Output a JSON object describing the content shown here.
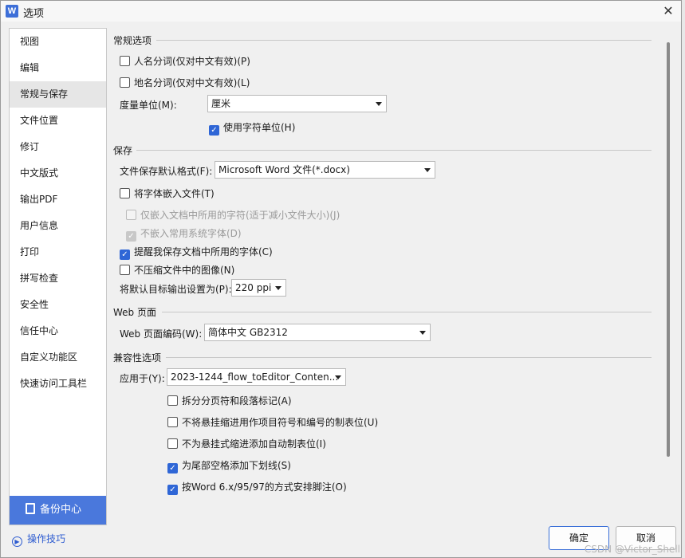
{
  "window": {
    "app_icon": "W",
    "title": "选项",
    "close": "✕"
  },
  "sidebar": {
    "items": [
      {
        "label": "视图"
      },
      {
        "label": "编辑"
      },
      {
        "label": "常规与保存"
      },
      {
        "label": "文件位置"
      },
      {
        "label": "修订"
      },
      {
        "label": "中文版式"
      },
      {
        "label": "输出PDF"
      },
      {
        "label": "用户信息"
      },
      {
        "label": "打印"
      },
      {
        "label": "拼写检查"
      },
      {
        "label": "安全性"
      },
      {
        "label": "信任中心"
      },
      {
        "label": "自定义功能区"
      },
      {
        "label": "快速访问工具栏"
      }
    ],
    "active_index": 2,
    "backup_label": "备份中心"
  },
  "tips_label": "操作技巧",
  "general": {
    "title": "常规选项",
    "person_name": {
      "label": "人名分词(仅对中文有效)(P)",
      "checked": false
    },
    "place_name": {
      "label": "地名分词(仅对中文有效)(L)",
      "checked": false
    },
    "unit_label": "度量单位(M):",
    "unit_value": "厘米",
    "char_unit": {
      "label": "使用字符单位(H)",
      "checked": true
    }
  },
  "save": {
    "title": "保存",
    "format_label": "文件保存默认格式(F):",
    "format_value": "Microsoft Word 文件(*.docx)",
    "embed_fonts": {
      "label": "将字体嵌入文件(T)",
      "checked": false
    },
    "embed_used_only": {
      "label": "仅嵌入文档中所用的字符(适于减小文件大小)(J)",
      "checked": false
    },
    "no_embed_system": {
      "label": "不嵌入常用系统字体(D)",
      "checked": true
    },
    "remind_fonts": {
      "label": "提醒我保存文档中所用的字体(C)",
      "checked": true
    },
    "no_compress": {
      "label": "不压缩文件中的图像(N)",
      "checked": false
    },
    "ppi_label": "将默认目标输出设置为(P):",
    "ppi_value": "220 ppi"
  },
  "web": {
    "title": "Web 页面",
    "encoding_label": "Web 页面编码(W):",
    "encoding_value": "简体中文 GB2312"
  },
  "compat": {
    "title": "兼容性选项",
    "apply_label": "应用于(Y):",
    "apply_value": "2023-1244_flow_toEditor_Conten...",
    "split_pages": {
      "label": "拆分分页符和段落标记(A)",
      "checked": false
    },
    "no_hanging": {
      "label": "不将悬挂缩进用作项目符号和编号的制表位(U)",
      "checked": false
    },
    "no_auto_tab": {
      "label": "不为悬挂式缩进添加自动制表位(I)",
      "checked": false
    },
    "underline_spaces": {
      "label": "为尾部空格添加下划线(S)",
      "checked": true
    },
    "word6_footnote": {
      "label": "按Word 6.x/95/97的方式安排脚注(O)",
      "checked": true
    }
  },
  "buttons": {
    "ok": "确定",
    "cancel": "取消"
  },
  "watermark": "CSDN @Victor_Shell"
}
